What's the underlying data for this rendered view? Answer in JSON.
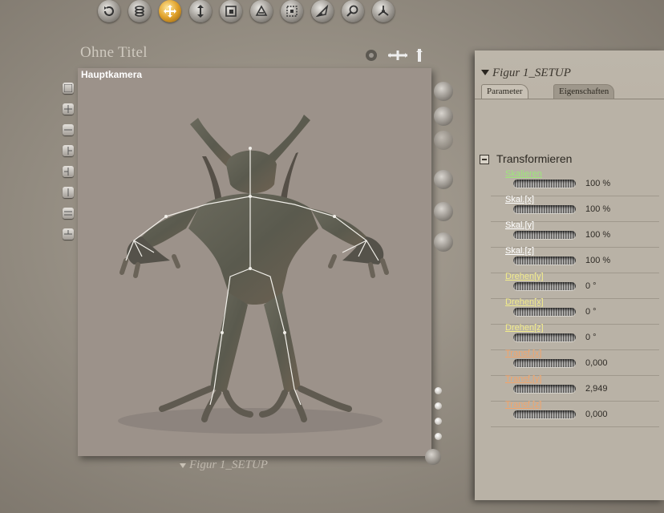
{
  "toolbar": {
    "buttons": [
      {
        "icon": "rotate-icon"
      },
      {
        "icon": "twist-icon"
      },
      {
        "icon": "move-icon",
        "active": true
      },
      {
        "icon": "translate-updown-icon"
      },
      {
        "icon": "scale-icon"
      },
      {
        "icon": "taper-icon"
      },
      {
        "icon": "chain-break-icon"
      },
      {
        "icon": "color-icon"
      },
      {
        "icon": "magnify-icon"
      },
      {
        "icon": "direct-manipulation-icon"
      }
    ]
  },
  "document": {
    "title": "Ohne Titel"
  },
  "viewport": {
    "camera_label": "Hauptkamera"
  },
  "figure_selector": {
    "label": "Figur 1_SETUP"
  },
  "panel": {
    "title": "Figur 1_SETUP",
    "tabs": [
      {
        "label": "Parameter",
        "active": true
      },
      {
        "label": "Eigenschaften",
        "active": false
      }
    ],
    "section": {
      "label": "Transformieren"
    },
    "params": [
      {
        "label": "Skalieren",
        "value": "100 %",
        "color": "#9de87a"
      },
      {
        "label": "Skal.[x]",
        "value": "100 %",
        "color": "#ffffff"
      },
      {
        "label": "Skal.[y]",
        "value": "100 %",
        "color": "#ffffff"
      },
      {
        "label": "Skal.[z]",
        "value": "100 %",
        "color": "#ffffff"
      },
      {
        "label": "Drehen[y]",
        "value": "0 °",
        "color": "#f2ec8a"
      },
      {
        "label": "Drehen[x]",
        "value": "0 °",
        "color": "#f2ec8a"
      },
      {
        "label": "Drehen[z]",
        "value": "0 °",
        "color": "#f2ec8a"
      },
      {
        "label": "Transf.[x]",
        "value": "0,000",
        "color": "#f3a46a"
      },
      {
        "label": "Transf.[y]",
        "value": "2,949",
        "color": "#f3a46a"
      },
      {
        "label": "Transf.[z]",
        "value": "0,000",
        "color": "#f3a46a"
      }
    ]
  }
}
